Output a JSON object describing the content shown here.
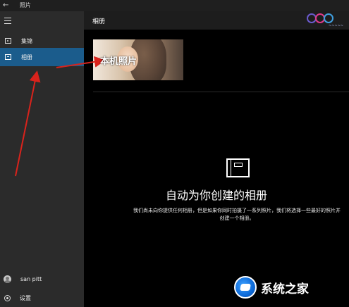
{
  "window": {
    "title": "照片"
  },
  "sidebar": {
    "items": [
      {
        "label": "集锦"
      },
      {
        "label": "相册"
      }
    ],
    "user": {
      "name": "san pitt"
    },
    "settings_label": "设置"
  },
  "header": {
    "title": "相册"
  },
  "album": {
    "label": "本机照片"
  },
  "empty_state": {
    "title": "自动为你创建的相册",
    "description": "我们尚未向你提供任何相册，但是如果你同时拍摄了一系列照片，我们将选择一些最好的照片并创建一个相册。"
  },
  "watermark": {
    "bottom_text": "系统之家"
  },
  "colors": {
    "accent": "#1b5c8c",
    "arrow": "#d9231c",
    "sidebar_bg": "#2b2b2b"
  }
}
